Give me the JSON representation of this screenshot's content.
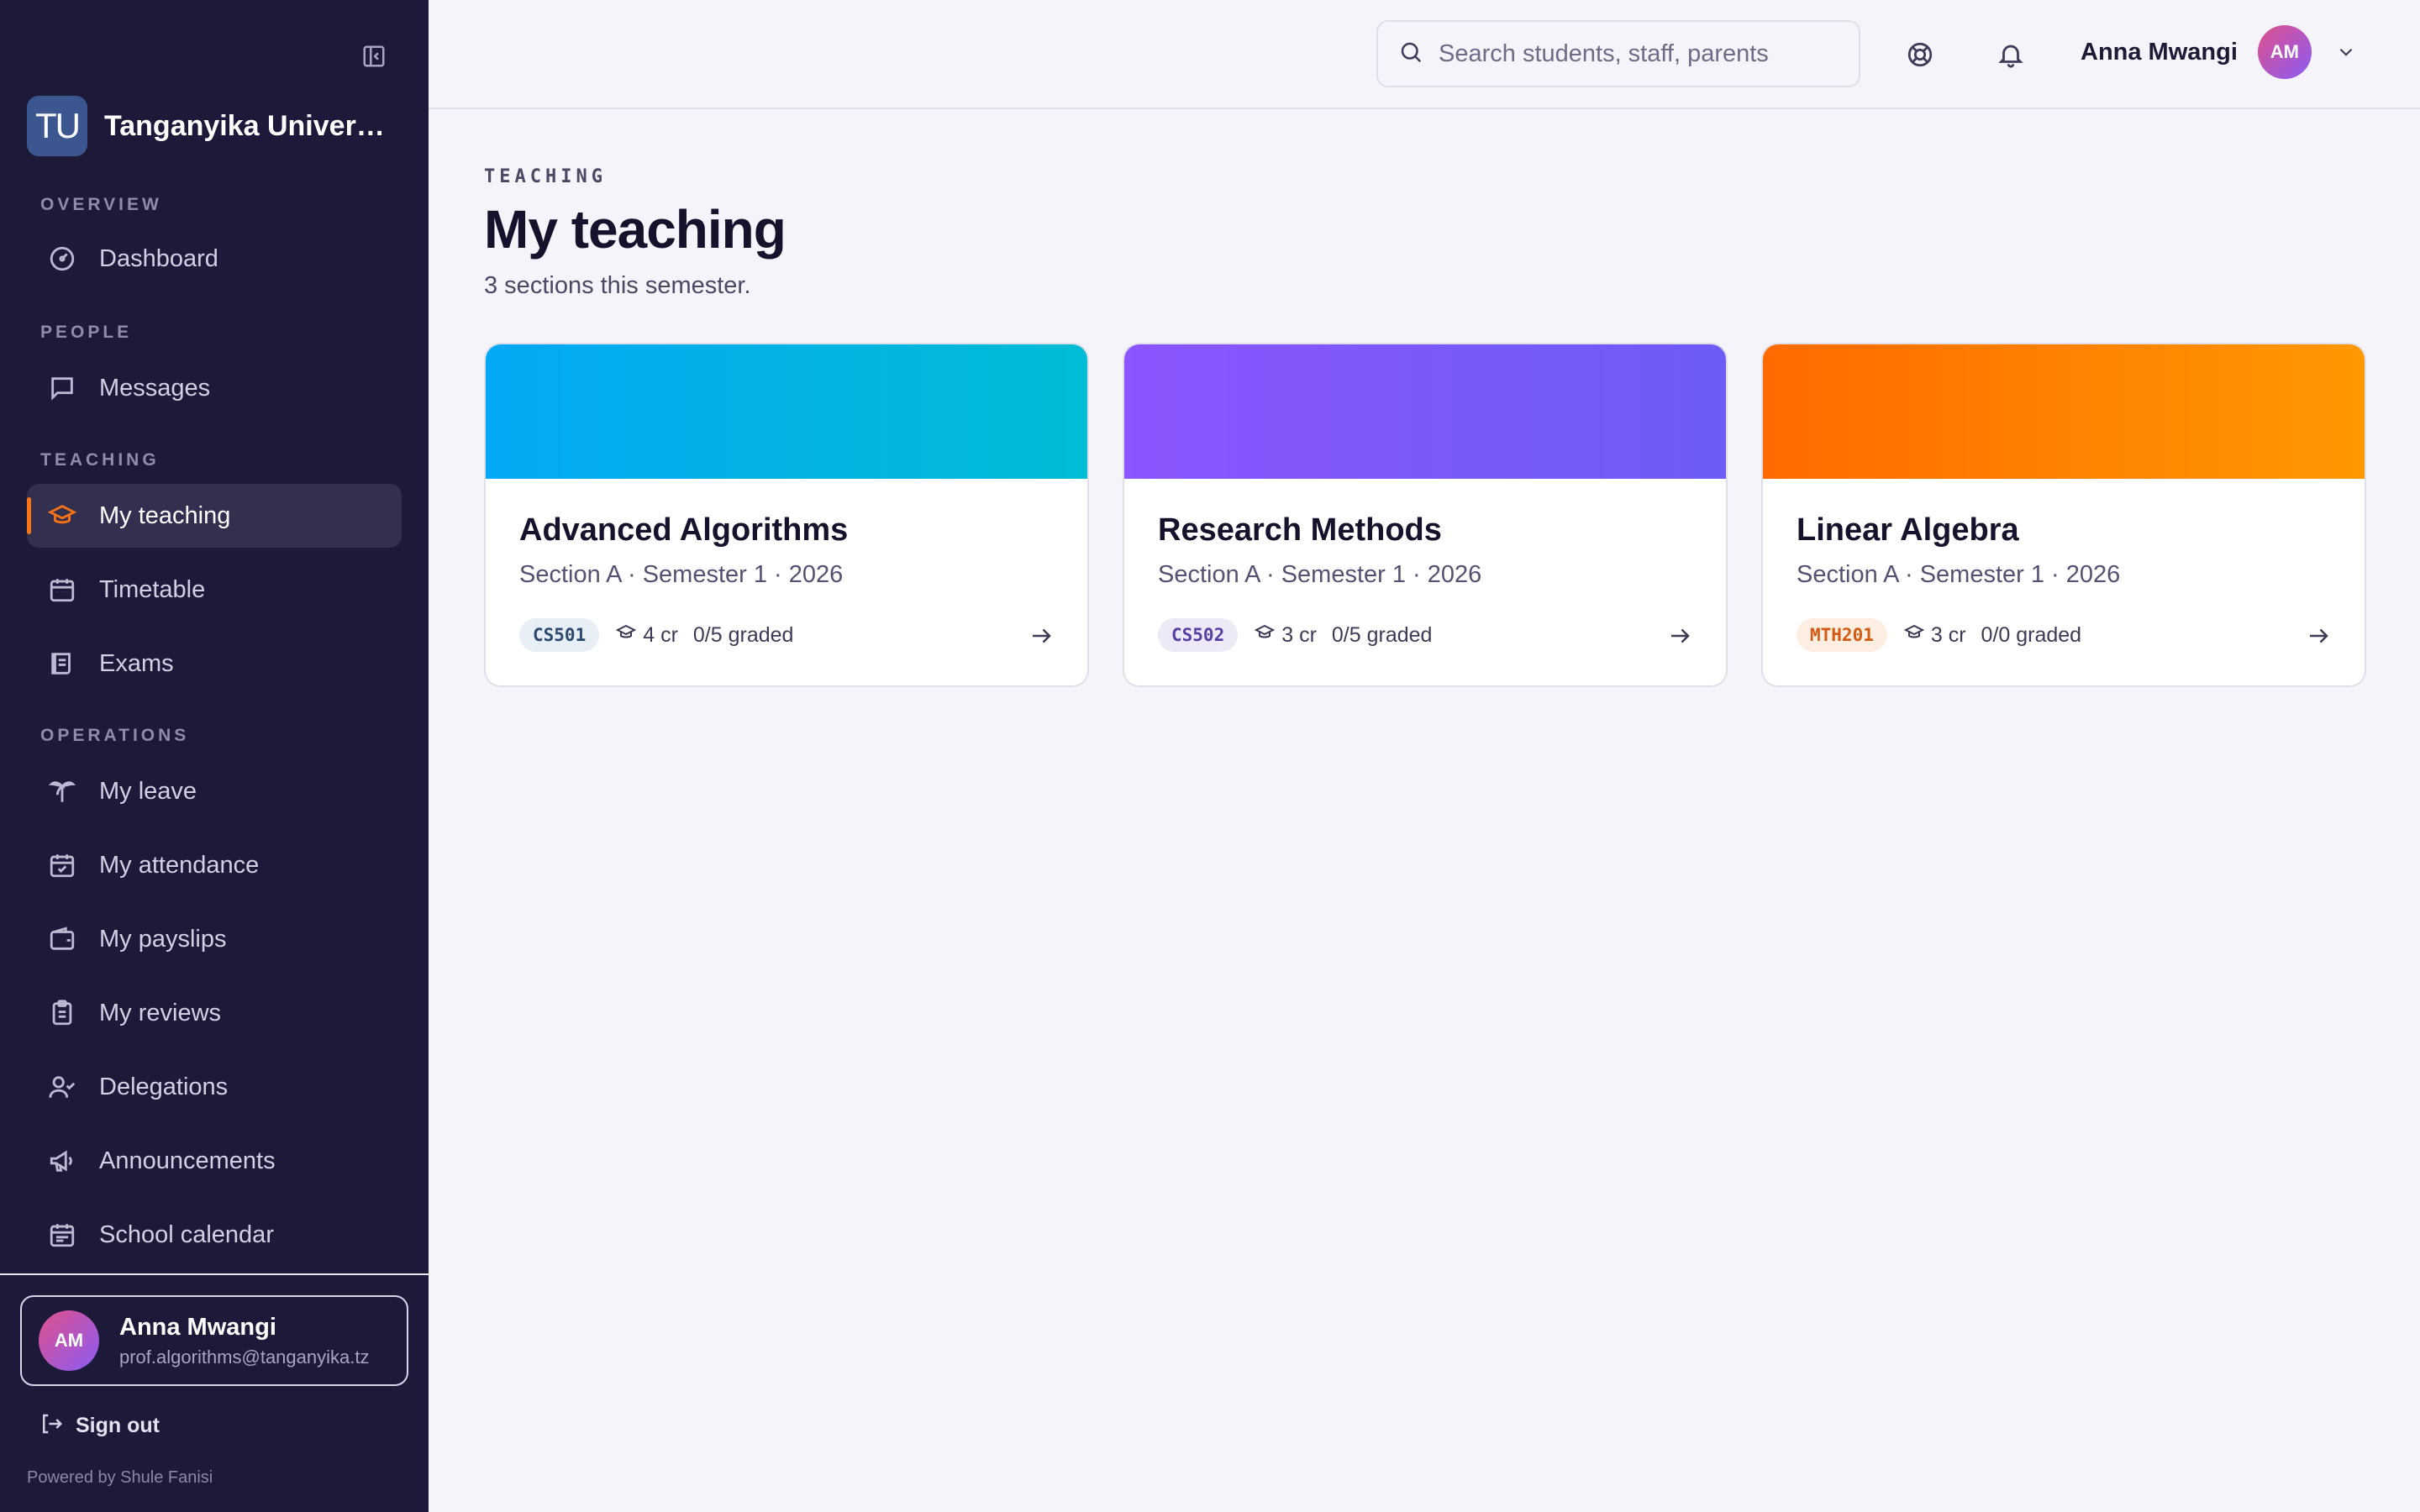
{
  "sidebar": {
    "brand_initials": "TU",
    "brand_name": "Tanganyika University",
    "sections": {
      "overview": "OVERVIEW",
      "people": "PEOPLE",
      "teaching": "TEACHING",
      "operations": "OPERATIONS"
    },
    "items": {
      "dashboard": "Dashboard",
      "messages": "Messages",
      "my_teaching": "My teaching",
      "timetable": "Timetable",
      "exams": "Exams",
      "my_leave": "My leave",
      "my_attendance": "My attendance",
      "my_payslips": "My payslips",
      "my_reviews": "My reviews",
      "delegations": "Delegations",
      "announcements": "Announcements",
      "school_calendar": "School calendar"
    },
    "active_item": "My teaching",
    "user": {
      "initials": "AM",
      "name": "Anna Mwangi",
      "email": "prof.algorithms@tanganyika.tz"
    },
    "sign_out": "Sign out",
    "powered_by": "Powered by Shule Fanisi"
  },
  "topbar": {
    "search_placeholder": "Search students, staff, parents",
    "user_name": "Anna Mwangi",
    "user_initials": "AM",
    "icons": [
      "lifebuoy-icon",
      "bell-icon",
      "chevron-down-icon"
    ]
  },
  "page": {
    "eyebrow": "TEACHING",
    "title": "My teaching",
    "subtitle": "3 sections this semester."
  },
  "cards": [
    {
      "title": "Advanced Algorithms",
      "subtitle": "Section A · Semester 1 · 2026",
      "code": "CS501",
      "credits": "4 cr",
      "graded": "0/5 graded",
      "gradient_from": "#03a9f4",
      "gradient_to": "#00bcd4",
      "code_bg": "#e8eef6",
      "code_color": "#2c4a6e"
    },
    {
      "title": "Research Methods",
      "subtitle": "Section A · Semester 1 · 2026",
      "code": "CS502",
      "credits": "3 cr",
      "graded": "0/5 graded",
      "gradient_from": "#8b55ff",
      "gradient_to": "#6d5cf6",
      "code_bg": "#ede9f7",
      "code_color": "#5a3fa3"
    },
    {
      "title": "Linear Algebra",
      "subtitle": "Section A · Semester 1 · 2026",
      "code": "MTH201",
      "credits": "3 cr",
      "graded": "0/0 graded",
      "gradient_from": "#ff6a00",
      "gradient_to": "#ff9800",
      "code_bg": "#fdeee2",
      "code_color": "#d35a12"
    }
  ],
  "colors": {
    "sidebar_bg": "#1c1a38",
    "accent": "#f97316",
    "page_bg": "#f5f4fa"
  }
}
